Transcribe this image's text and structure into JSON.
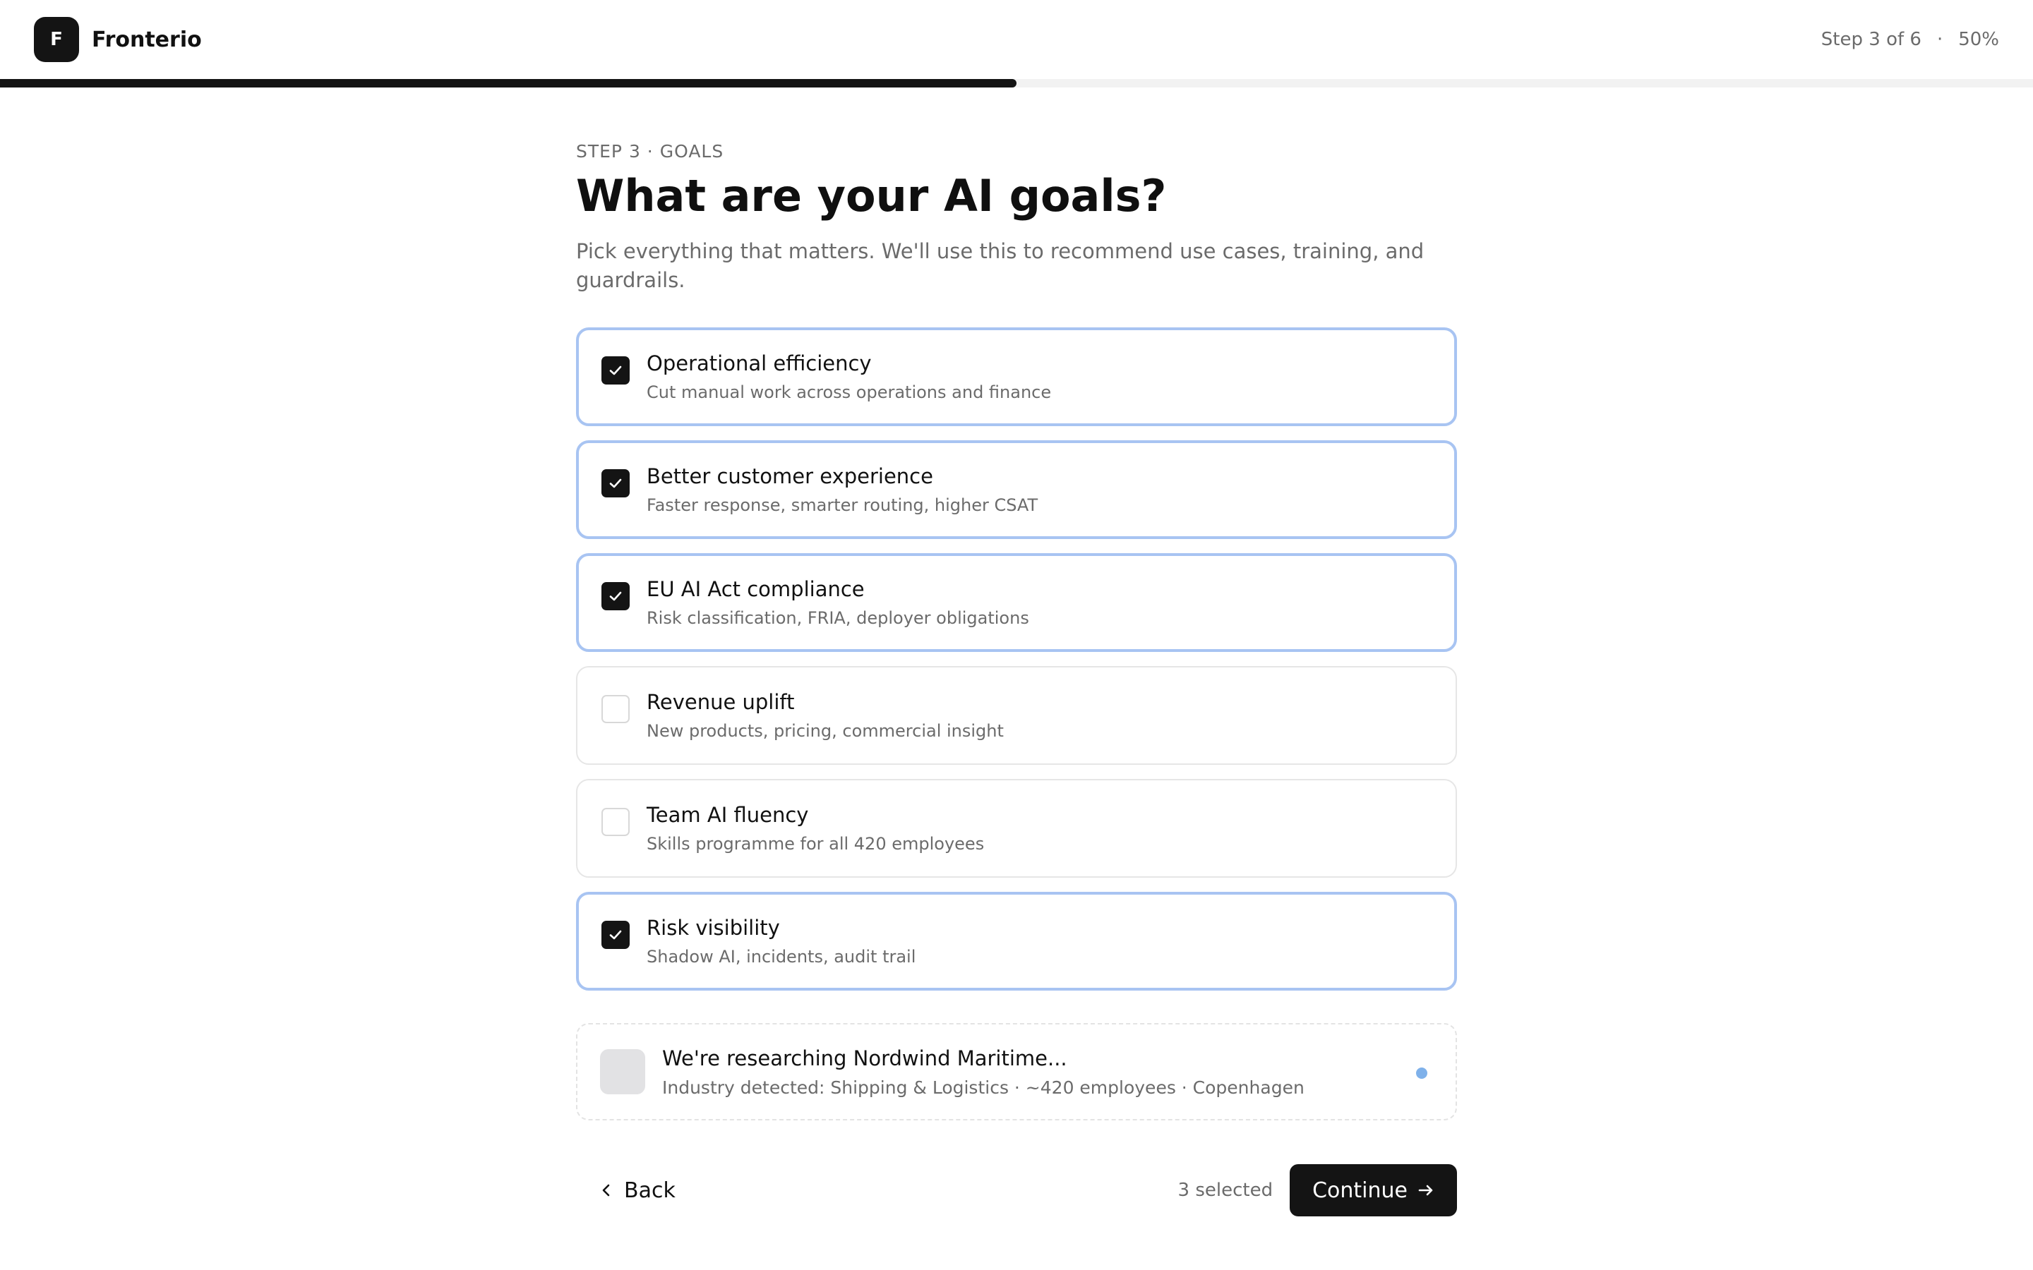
{
  "app": {
    "logo_letter": "F",
    "name": "Fronterio"
  },
  "progress": {
    "step_label": "Step 3 of 6",
    "separator": "·",
    "percent_label": "50%",
    "fraction": 0.5
  },
  "header": {
    "eyebrow": "STEP 3 · GOALS",
    "title": "What are your AI goals?",
    "subtitle": "Pick everything that matters. We'll use this to recommend use cases, training, and guardrails."
  },
  "goals": [
    {
      "title": "Operational efficiency",
      "description": "Cut manual work across operations and finance",
      "checked": true
    },
    {
      "title": "Better customer experience",
      "description": "Faster response, smarter routing, higher CSAT",
      "checked": true
    },
    {
      "title": "EU AI Act compliance",
      "description": "Risk classification, FRIA, deployer obligations",
      "checked": true
    },
    {
      "title": "Revenue uplift",
      "description": "New products, pricing, commercial insight",
      "checked": false
    },
    {
      "title": "Team AI fluency",
      "description": "Skills programme for all 420 employees",
      "checked": false
    },
    {
      "title": "Risk visibility",
      "description": "Shadow AI, incidents, audit trail",
      "checked": true
    }
  ],
  "research": {
    "title": "We're researching Nordwind Maritime...",
    "details": "Industry detected: Shipping & Logistics · ~420 employees · Copenhagen"
  },
  "footer": {
    "back_label": "Back",
    "selected_count": "3 selected",
    "continue_label": "Continue"
  },
  "colors": {
    "accent_dark": "#141414",
    "selected_border": "#a8c4f2",
    "status_dot": "#7fb1ea"
  },
  "icons": {
    "check": "check-icon",
    "back": "chevron-left-icon",
    "continue": "arrow-right-icon"
  }
}
